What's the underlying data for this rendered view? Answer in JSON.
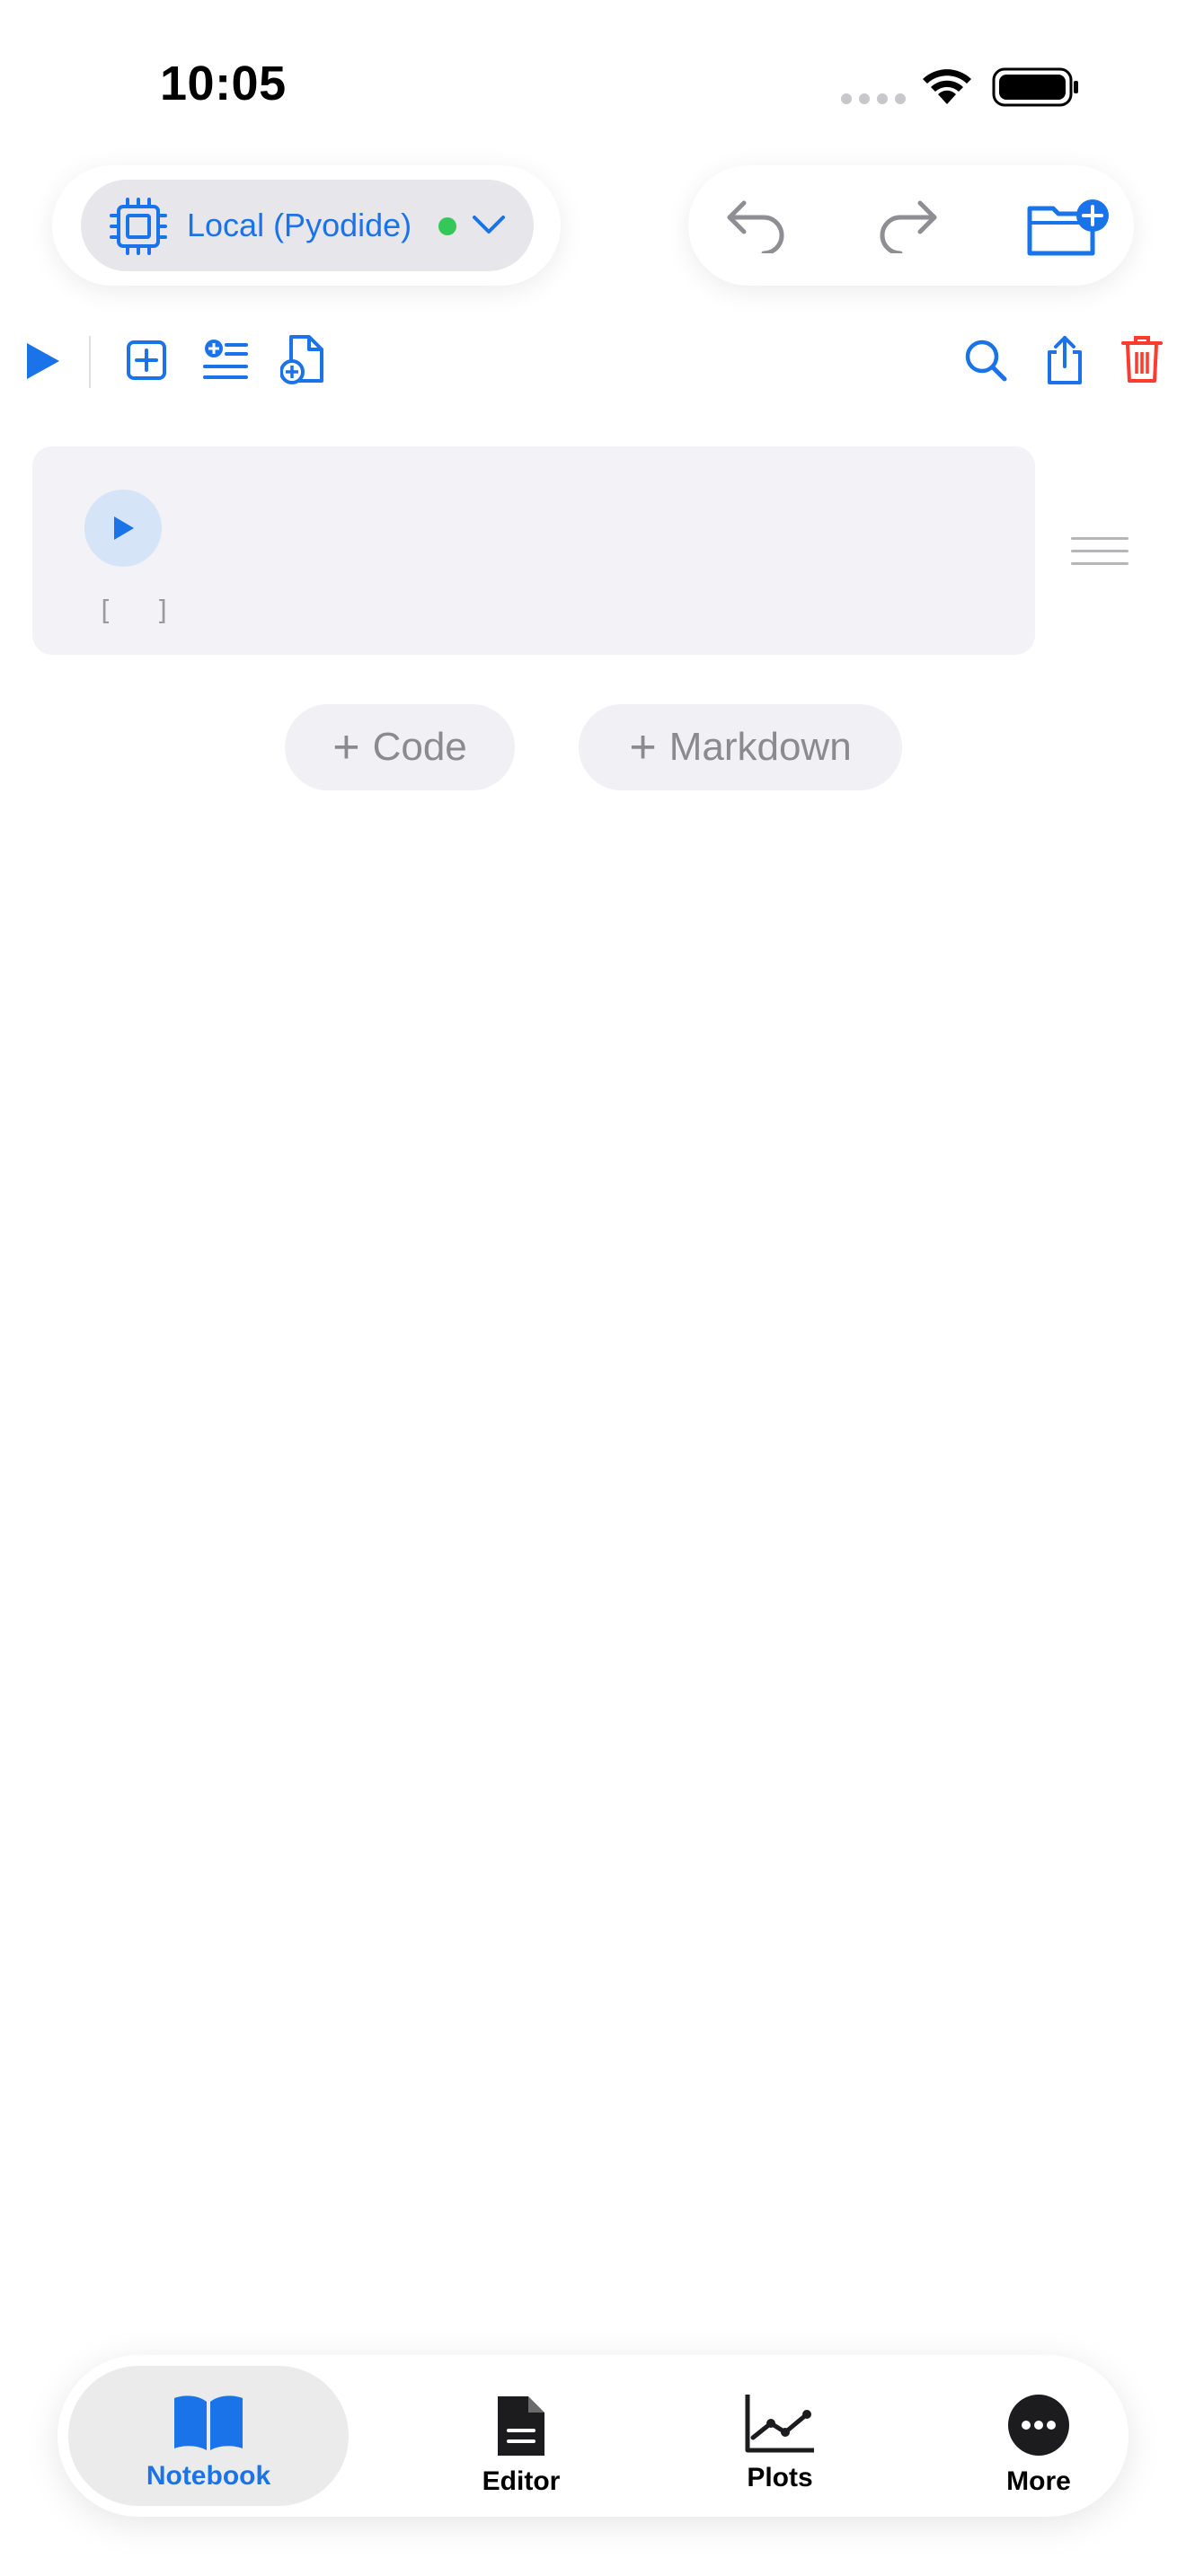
{
  "status_bar": {
    "time": "10:05"
  },
  "kernel": {
    "label": "Local (Pyodide)",
    "status_color": "#34c759"
  },
  "colors": {
    "accent": "#1a73e8",
    "danger": "#ff3b30",
    "muted": "#8a8a8f"
  },
  "toolbar": {
    "icons": [
      "run-all-icon",
      "add-cell-icon",
      "insert-list-icon",
      "new-file-icon",
      "search-icon",
      "share-icon",
      "trash-icon"
    ]
  },
  "cell": {
    "execution_count": "[ ]"
  },
  "add_buttons": {
    "code_plus": "+",
    "code_label": "Code",
    "markdown_plus": "+",
    "markdown_label": "Markdown"
  },
  "tabs": [
    {
      "label": "Notebook",
      "icon": "book-icon",
      "active": true
    },
    {
      "label": "Editor",
      "icon": "document-icon",
      "active": false
    },
    {
      "label": "Plots",
      "icon": "chart-icon",
      "active": false
    },
    {
      "label": "More",
      "icon": "ellipsis-icon",
      "active": false
    }
  ]
}
